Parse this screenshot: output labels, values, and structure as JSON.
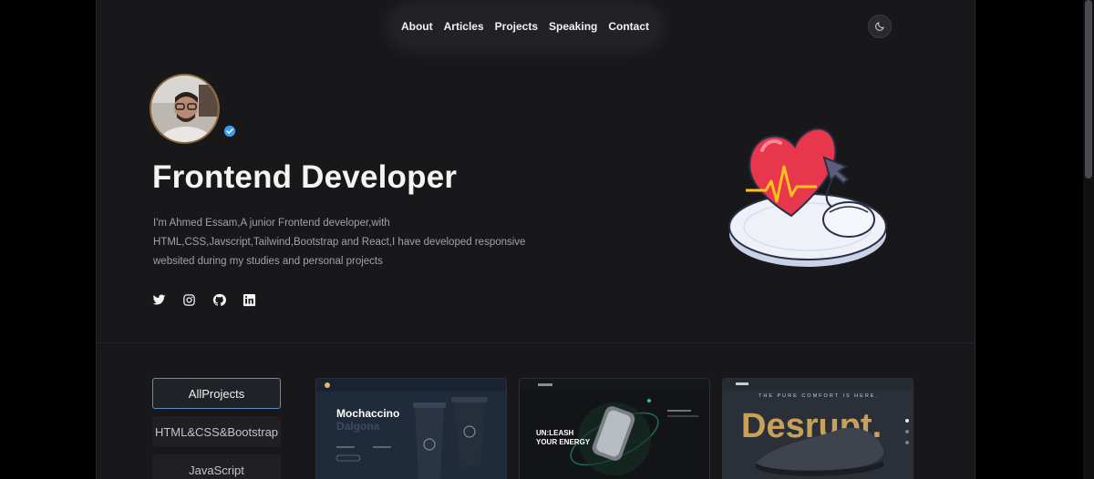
{
  "nav": {
    "items": [
      "About",
      "Articles",
      "Projects",
      "Speaking",
      "Contact"
    ],
    "theme_icon": "moon-icon"
  },
  "hero": {
    "title": "Frontend Developer",
    "description": "I'm Ahmed Essam,A junior Frontend developer,with HTML,CSS,Javscript,Tailwind,Bootstrap and React,I have developed responsive websited during my studies and personal projects",
    "socials": [
      "twitter-icon",
      "instagram-icon",
      "github-icon",
      "linkedin-icon"
    ]
  },
  "filters": {
    "items": [
      "AllProjects",
      "HTML&CSS&Bootstrap",
      "JavaScript"
    ],
    "active": "AllProjects"
  },
  "projects": [
    {
      "title_line1": "Mochaccino",
      "title_line2": "Dalgona"
    },
    {
      "title_line1": "UN:LEASH",
      "title_line2": "YOUR ENERGY"
    },
    {
      "tagline": "THE PURE COMFORT IS HERE.",
      "title": "Desrupt."
    }
  ],
  "colors": {
    "accent": "#5a8fc4",
    "background": "#18181b",
    "verified": "#3b9cf0"
  }
}
